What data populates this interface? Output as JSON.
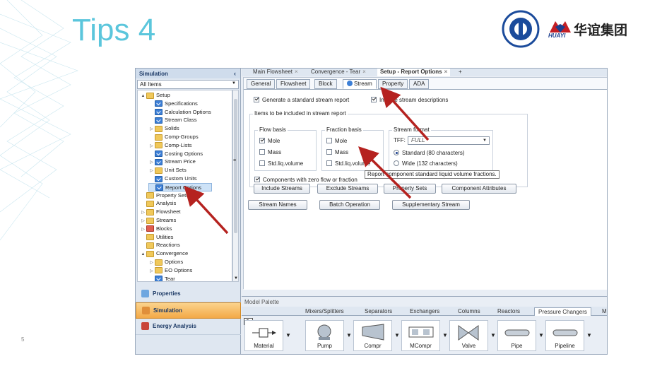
{
  "slide": {
    "title": "Tips 4",
    "page_number": "5",
    "logo_brand": "华谊集团",
    "logo_sub": "HUAYI"
  },
  "nav": {
    "header": "Simulation",
    "filter": "All Items",
    "tree": [
      {
        "label": "Setup",
        "depth": 0,
        "exp": "▲",
        "icon": "folder"
      },
      {
        "label": "Specifications",
        "depth": 1,
        "exp": "",
        "icon": "check"
      },
      {
        "label": "Calculation Options",
        "depth": 1,
        "exp": "",
        "icon": "check"
      },
      {
        "label": "Stream Class",
        "depth": 1,
        "exp": "",
        "icon": "check"
      },
      {
        "label": "Solids",
        "depth": 1,
        "exp": "▷",
        "icon": "folder"
      },
      {
        "label": "Comp-Groups",
        "depth": 1,
        "exp": "",
        "icon": "folder"
      },
      {
        "label": "Comp-Lists",
        "depth": 1,
        "exp": "▷",
        "icon": "folder"
      },
      {
        "label": "Costing Options",
        "depth": 1,
        "exp": "",
        "icon": "check"
      },
      {
        "label": "Stream Price",
        "depth": 1,
        "exp": "▷",
        "icon": "check"
      },
      {
        "label": "Unit Sets",
        "depth": 1,
        "exp": "▷",
        "icon": "folder"
      },
      {
        "label": "Custom Units",
        "depth": 1,
        "exp": "",
        "icon": "check"
      },
      {
        "label": "Report Options",
        "depth": 1,
        "exp": "",
        "icon": "check",
        "selected": true
      },
      {
        "label": "Property Sets",
        "depth": 0,
        "exp": "",
        "icon": "folder"
      },
      {
        "label": "Analysis",
        "depth": 0,
        "exp": "",
        "icon": "folder"
      },
      {
        "label": "Flowsheet",
        "depth": 0,
        "exp": "▷",
        "icon": "folder"
      },
      {
        "label": "Streams",
        "depth": 0,
        "exp": "▷",
        "icon": "folder"
      },
      {
        "label": "Blocks",
        "depth": 0,
        "exp": "▷",
        "icon": "redf"
      },
      {
        "label": "Utilities",
        "depth": 0,
        "exp": "",
        "icon": "folder"
      },
      {
        "label": "Reactions",
        "depth": 0,
        "exp": "",
        "icon": "folder"
      },
      {
        "label": "Convergence",
        "depth": 0,
        "exp": "▲",
        "icon": "folder"
      },
      {
        "label": "Options",
        "depth": 1,
        "exp": "▷",
        "icon": "folder"
      },
      {
        "label": "EO Options",
        "depth": 1,
        "exp": "▷",
        "icon": "folder"
      },
      {
        "label": "Tear",
        "depth": 1,
        "exp": "",
        "icon": "check"
      }
    ],
    "buttons": [
      {
        "label": "Properties",
        "active": false
      },
      {
        "label": "Simulation",
        "active": true
      },
      {
        "label": "Energy Analysis",
        "active": false
      }
    ]
  },
  "doc_tabs": [
    {
      "label": "Main Flowsheet",
      "active": false
    },
    {
      "label": "Convergence - Tear",
      "active": false
    },
    {
      "label": "Setup - Report Options",
      "active": true
    }
  ],
  "form_tabs": [
    "General",
    "Flowsheet",
    "Block",
    "Stream",
    "Property",
    "ADA"
  ],
  "active_form_tab": "Stream",
  "stream": {
    "generate_label": "Generate a standard stream report",
    "generate_checked": true,
    "include_desc_label": "Include stream descriptions",
    "include_desc_checked": true,
    "items_group": "Items to be included in stream report",
    "flow_basis": {
      "title": "Flow basis",
      "items": [
        {
          "label": "Mole",
          "checked": true
        },
        {
          "label": "Mass",
          "checked": false
        },
        {
          "label": "Std.liq.volume",
          "checked": false
        }
      ]
    },
    "fraction_basis": {
      "title": "Fraction basis",
      "items": [
        {
          "label": "Mole",
          "checked": false
        },
        {
          "label": "Mass",
          "checked": false
        },
        {
          "label": "Std.liq.volume",
          "checked": false
        }
      ]
    },
    "stream_format": {
      "title": "Stream format",
      "tff_label": "TFF:",
      "tff_value": "FULL",
      "standard_label": "Standard (80 characters)",
      "wide_label": "Wide (132 characters)",
      "selected": "standard"
    },
    "zero_flow_label": "Components with zero flow or fraction",
    "zero_flow_checked": true,
    "tooltip": "Report component standard liquid volume fractions.",
    "buttons_row1": [
      "Include Streams",
      "Exclude Streams",
      "Property Sets",
      "Component Attributes"
    ],
    "buttons_row2": [
      "Stream Names",
      "Batch Operation",
      "Supplementary Stream"
    ]
  },
  "palette": {
    "title": "Model Palette",
    "tabs": [
      "Mixers/Splitters",
      "Separators",
      "Exchangers",
      "Columns",
      "Reactors",
      "Pressure Changers",
      "M"
    ],
    "active_tab": "Pressure Changers",
    "items": [
      "Material",
      "Pump",
      "Compr",
      "MCompr",
      "Valve",
      "Pipe",
      "Pipeline"
    ]
  },
  "colors": {
    "title": "#5bc6dc",
    "arrow": "#b5221f",
    "active_nav": "#f3a947"
  }
}
